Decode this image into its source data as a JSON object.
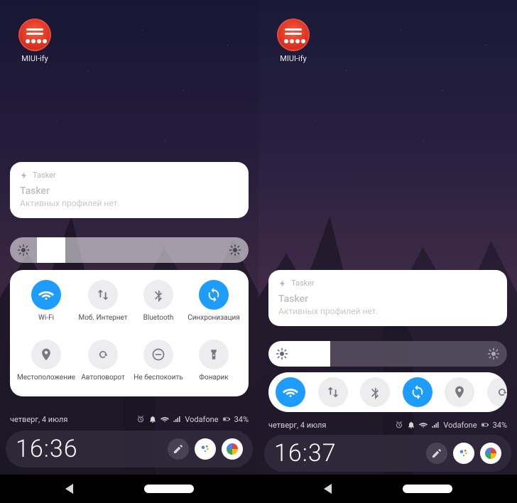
{
  "app_icon": {
    "label": "MIUI-ify"
  },
  "notification": {
    "app_name": "Tasker",
    "title": "Tasker",
    "body": "Активных профилей нет."
  },
  "brightness": {
    "level_pct": 24
  },
  "quick_tiles": [
    {
      "id": "wifi",
      "label": "Wi-Fi",
      "active": true
    },
    {
      "id": "mobile-data",
      "label": "Моб. Интернет",
      "active": false
    },
    {
      "id": "bluetooth",
      "label": "Bluetooth",
      "active": false
    },
    {
      "id": "sync",
      "label": "Синхронизация",
      "active": true
    },
    {
      "id": "location",
      "label": "Местоположение",
      "active": false
    },
    {
      "id": "autorotate",
      "label": "Автоповорот",
      "active": false
    },
    {
      "id": "dnd",
      "label": "Не беспокоить",
      "active": false
    },
    {
      "id": "flashlight",
      "label": "Фонарик",
      "active": false
    }
  ],
  "compact_tiles": [
    {
      "id": "wifi",
      "active": true
    },
    {
      "id": "mobile-data",
      "active": false
    },
    {
      "id": "bluetooth",
      "active": false
    },
    {
      "id": "sync",
      "active": true
    },
    {
      "id": "location",
      "active": false
    },
    {
      "id": "autorotate",
      "active": false
    }
  ],
  "status": {
    "date": "четверг, 4 июля",
    "carrier": "Vodafone",
    "battery_pct": "34%"
  },
  "left": {
    "clock": "16:36"
  },
  "right": {
    "clock": "16:37"
  }
}
